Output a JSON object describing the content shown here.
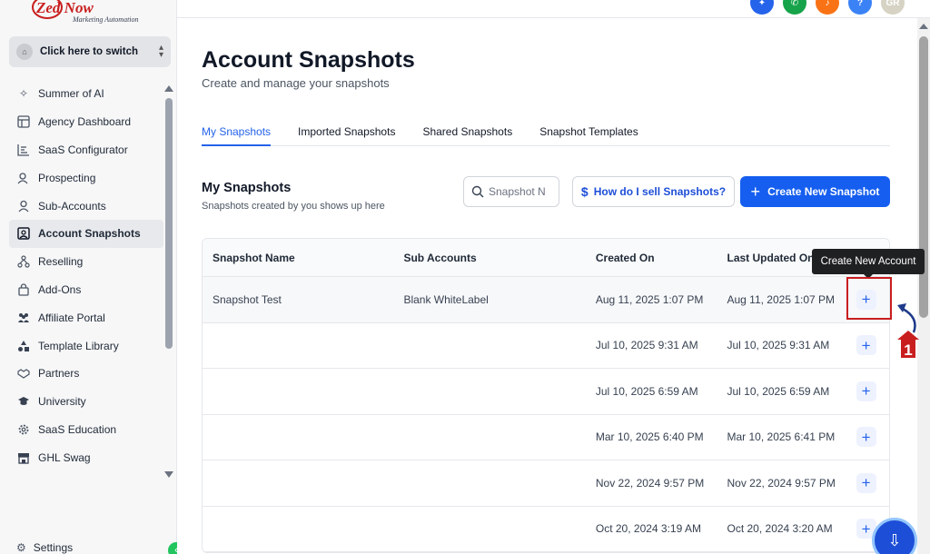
{
  "brand": {
    "logo_text": "Zed Now",
    "logo_tagline": "Marketing Automation"
  },
  "switcher": {
    "label": "Click here to switch"
  },
  "sidebar": {
    "items": [
      {
        "label": "Summer of AI",
        "icon": "sparkle-icon"
      },
      {
        "label": "Agency Dashboard",
        "icon": "dashboard-icon"
      },
      {
        "label": "SaaS Configurator",
        "icon": "chart-icon"
      },
      {
        "label": "Prospecting",
        "icon": "prospecting-icon"
      },
      {
        "label": "Sub-Accounts",
        "icon": "user-icon"
      },
      {
        "label": "Account Snapshots",
        "icon": "snapshot-icon",
        "active": true
      },
      {
        "label": "Reselling",
        "icon": "reselling-icon"
      },
      {
        "label": "Add-Ons",
        "icon": "bag-icon"
      },
      {
        "label": "Affiliate Portal",
        "icon": "people-icon"
      },
      {
        "label": "Template Library",
        "icon": "shapes-icon"
      },
      {
        "label": "Partners",
        "icon": "handshake-icon"
      },
      {
        "label": "University",
        "icon": "graduation-cap-icon"
      },
      {
        "label": "SaaS Education",
        "icon": "gear-icon"
      },
      {
        "label": "GHL Swag",
        "icon": "store-icon"
      }
    ],
    "settings_label": "Settings"
  },
  "topbar": {
    "avatar_initials": "GR",
    "icon_colors": [
      "#2563eb",
      "#16a34a",
      "#f97316",
      "#3b82f6",
      "#d6d3c4"
    ]
  },
  "page": {
    "title": "Account Snapshots",
    "subtitle": "Create and manage your snapshots"
  },
  "tabs": [
    {
      "label": "My Snapshots",
      "active": true
    },
    {
      "label": "Imported Snapshots"
    },
    {
      "label": "Shared Snapshots"
    },
    {
      "label": "Snapshot Templates"
    }
  ],
  "section": {
    "title": "My Snapshots",
    "subtitle": "Snapshots created by you shows up here"
  },
  "search": {
    "placeholder": "Snapshot Name"
  },
  "help_button": {
    "label": "How do I sell Snapshots?"
  },
  "create_button": {
    "label": "Create New Snapshot"
  },
  "table": {
    "headers": [
      "Snapshot Name",
      "Sub Accounts",
      "Created On",
      "Last Updated On"
    ],
    "rows": [
      {
        "name": "Snapshot Test",
        "sub_accounts": "Blank WhiteLabel",
        "created": "Aug 11, 2025 1:07 PM",
        "updated": "Aug 11, 2025 1:07 PM"
      },
      {
        "name": "",
        "sub_accounts": "",
        "created": "Jul 10, 2025 9:31 AM",
        "updated": "Jul 10, 2025 9:31 AM"
      },
      {
        "name": "",
        "sub_accounts": "",
        "created": "Jul 10, 2025 6:59 AM",
        "updated": "Jul 10, 2025 6:59 AM"
      },
      {
        "name": "",
        "sub_accounts": "",
        "created": "Mar 10, 2025 6:40 PM",
        "updated": "Mar 10, 2025 6:41 PM"
      },
      {
        "name": "",
        "sub_accounts": "",
        "created": "Nov 22, 2024 9:57 PM",
        "updated": "Nov 22, 2024 9:57 PM"
      },
      {
        "name": "",
        "sub_accounts": "",
        "created": "Oct 20, 2024 3:19 AM",
        "updated": "Oct 20, 2024 3:20 AM"
      }
    ],
    "row_action": "+"
  },
  "tooltip": {
    "text": "Create New Account"
  },
  "annotation": {
    "step_number": "1",
    "accent_color": "#c81e1e"
  }
}
